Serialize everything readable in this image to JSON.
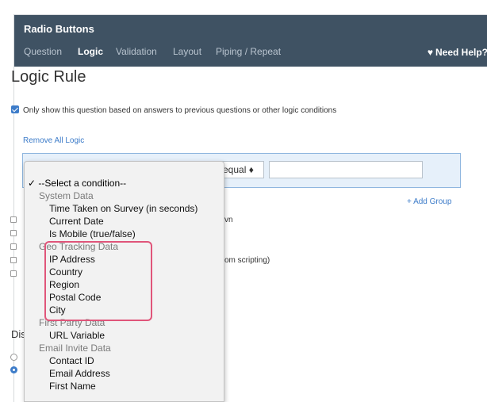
{
  "window": {
    "title": "Radio Buttons",
    "tabs": [
      {
        "label": "Question",
        "active": false
      },
      {
        "label": "Logic",
        "active": true
      },
      {
        "label": "Validation",
        "active": false
      },
      {
        "label": "Layout",
        "active": false
      },
      {
        "label": "Piping / Repeat",
        "active": false
      }
    ],
    "help_label": "Need Help?",
    "help_icon": "heart-icon"
  },
  "logic": {
    "heading": "Logic Rule",
    "only_show_label": "Only show this question based on answers to previous questions or other logic conditions",
    "only_show_checked": true,
    "remove_all_label": "Remove All Logic",
    "operator_value": "actly equal ♦",
    "value_input": "",
    "add_group_label": "+ Add Group"
  },
  "partial_options": {
    "row1_suffix": "vn",
    "row4_suffix": "om scripting)"
  },
  "display": {
    "heading_partial": "Dis"
  },
  "dropdown": {
    "selected_mark": "✓",
    "items": [
      {
        "type": "selected",
        "label": "--Select a condition--"
      },
      {
        "type": "group",
        "label": "System Data"
      },
      {
        "type": "option",
        "label": "Time Taken on Survey (in seconds)"
      },
      {
        "type": "option",
        "label": "Current Date"
      },
      {
        "type": "option",
        "label": "Is Mobile (true/false)"
      },
      {
        "type": "group",
        "label": "Geo Tracking Data"
      },
      {
        "type": "option",
        "label": "IP Address"
      },
      {
        "type": "option",
        "label": "Country"
      },
      {
        "type": "option",
        "label": "Region"
      },
      {
        "type": "option",
        "label": "Postal Code"
      },
      {
        "type": "option",
        "label": "City"
      },
      {
        "type": "group",
        "label": "First Party Data"
      },
      {
        "type": "option",
        "label": "URL Variable"
      },
      {
        "type": "group",
        "label": "Email Invite Data"
      },
      {
        "type": "option",
        "label": "Contact ID"
      },
      {
        "type": "option",
        "label": "Email Address"
      },
      {
        "type": "option",
        "label": "First Name"
      }
    ]
  },
  "colors": {
    "header_bg": "#3f5263",
    "accent": "#3d7cc9",
    "highlight": "#e0557a",
    "rule_bg": "#e6f0fa"
  }
}
